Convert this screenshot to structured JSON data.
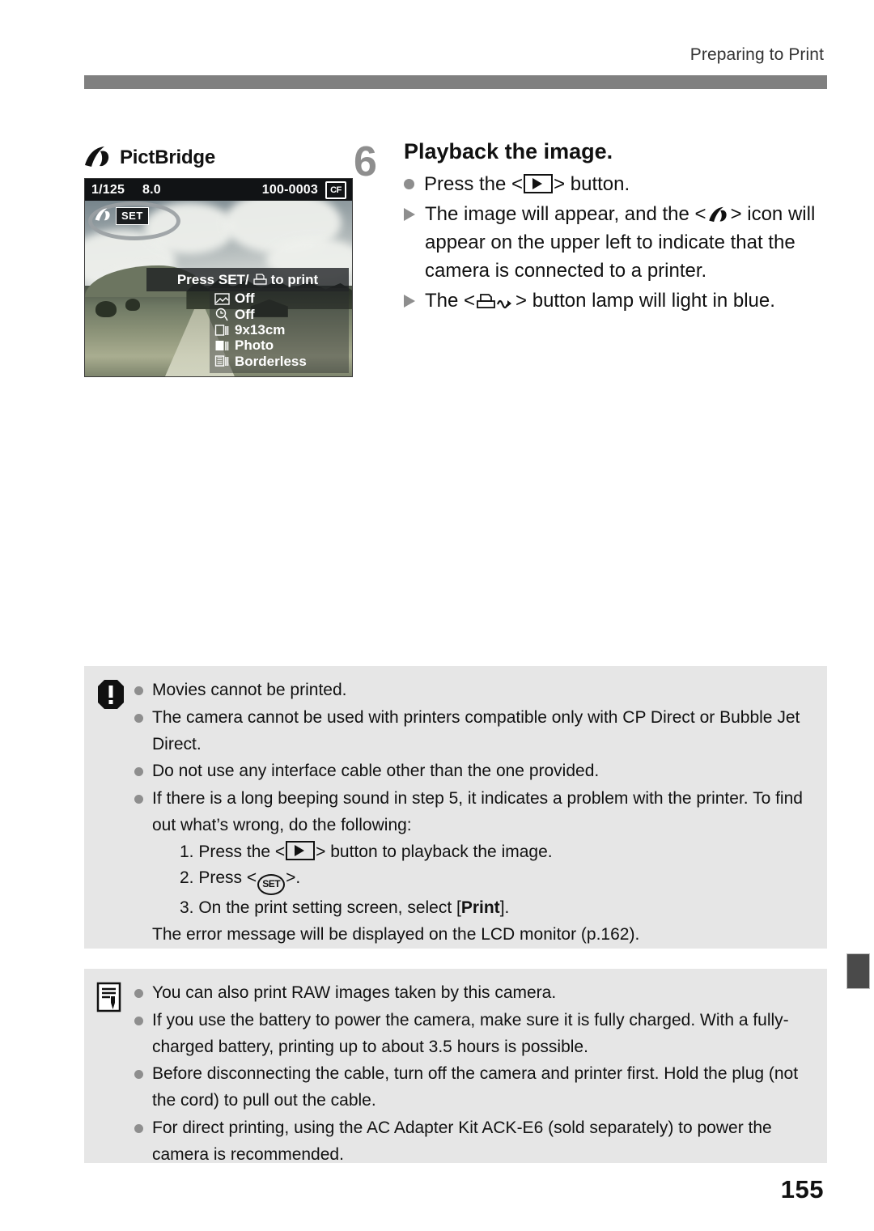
{
  "header": {
    "running_title": "Preparing to Print"
  },
  "lcd": {
    "logo_label": "PictBridge",
    "status": {
      "shutter_speed": "1/125",
      "aperture": "8.0",
      "file_number": "100-0003",
      "card_icon_label": "CF"
    },
    "connected_chip": "SET",
    "banner_prefix": "Press SET/",
    "banner_suffix": "to print",
    "settings": [
      {
        "icon": "print-effect-icon",
        "value": "Off"
      },
      {
        "icon": "date-imprint-icon",
        "value": "Off"
      },
      {
        "icon": "paper-size-icon",
        "value": "9x13cm"
      },
      {
        "icon": "paper-type-icon",
        "value": "Photo"
      },
      {
        "icon": "page-layout-icon",
        "value": "Borderless"
      }
    ]
  },
  "step": {
    "number": "6",
    "title": "Playback the image.",
    "items": [
      {
        "marker": "dot",
        "prefix": "Press the <",
        "icon": "playback-icon",
        "suffix": "> button."
      },
      {
        "marker": "triangle",
        "prefix": "The image will appear, and the <",
        "icon": "pictbridge-icon",
        "suffix": "> icon will appear on the upper left to indicate that the camera is connected to a printer."
      },
      {
        "marker": "triangle",
        "prefix": "The <",
        "icon": "direct-print-icon",
        "suffix": "> button lamp will light in blue."
      }
    ]
  },
  "warning_box": {
    "icon": "caution-icon",
    "items": [
      "Movies cannot be printed.",
      "The camera cannot be used with printers compatible only with CP Direct or Bubble Jet Direct.",
      "Do not use any interface cable other than the one provided.",
      "If there is a long beeping sound in step 5, it indicates a problem with the printer. To find out what’s wrong, do the following:"
    ],
    "sub_steps": {
      "one_prefix": "1. Press the <",
      "one_icon": "playback-icon",
      "one_suffix": "> button to playback the image.",
      "two_prefix": "2. Press <",
      "two_icon": "set-button-icon",
      "two_icon_label": "SET",
      "two_suffix": ">.",
      "three_prefix": "3. On the print setting screen, select [",
      "three_bold": "Print",
      "three_suffix": "]."
    },
    "trailing": "The error message will be displayed on the LCD monitor (p.162)."
  },
  "note_box": {
    "icon": "note-icon",
    "items": [
      "You can also print RAW images taken by this camera.",
      "If you use the battery to power the camera, make sure it is fully charged. With a fully-charged battery, printing up to about 3.5 hours is possible.",
      "Before disconnecting the cable, turn off the camera and printer first. Hold the plug (not the cord) to pull out the cable.",
      "For direct printing, using the AC Adapter Kit ACK-E6 (sold separately) to power the camera is recommended."
    ]
  },
  "page_number": "155"
}
